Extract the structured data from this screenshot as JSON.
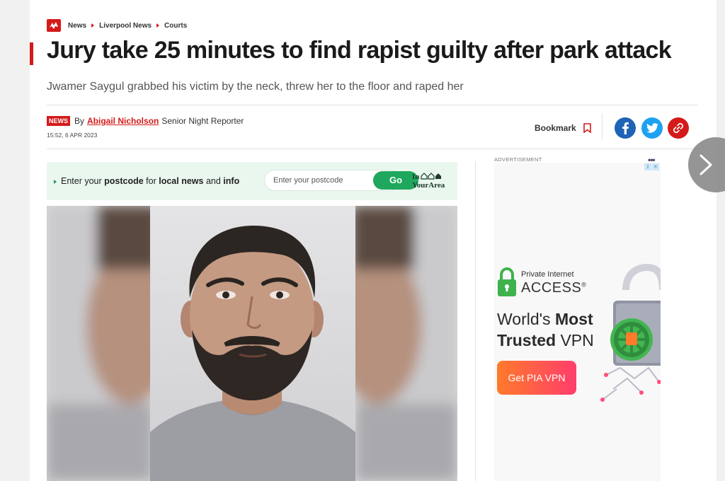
{
  "breadcrumb": {
    "items": [
      "News",
      "Liverpool News",
      "Courts"
    ]
  },
  "article": {
    "headline": "Jury take 25 minutes to find rapist guilty after park attack",
    "standfirst": "Jwamer Saygul grabbed his victim by the neck, threw her to the floor and raped her",
    "tag": "NEWS",
    "by": "By",
    "author": "Abigail Nicholson",
    "role": "Senior Night Reporter",
    "date": "15:52, 6 APR 2023"
  },
  "actions": {
    "bookmark_label": "Bookmark",
    "social": [
      {
        "name": "facebook",
        "icon": "facebook-icon"
      },
      {
        "name": "twitter",
        "icon": "twitter-icon"
      },
      {
        "name": "copy-link",
        "icon": "link-icon"
      }
    ]
  },
  "postcode": {
    "prefix": "Enter your ",
    "b1": "postcode",
    "mid1": " for ",
    "b2": "local news",
    "mid2": " and ",
    "b3": "info",
    "placeholder": "Enter your postcode",
    "go_label": "Go",
    "logo_line1": "In",
    "logo_line2": "YourArea"
  },
  "ad": {
    "label": "ADVERTISEMENT",
    "menu": "•••",
    "brand_line1": "Private Internet",
    "brand_line2": "ACCESS",
    "reg": "®",
    "headline_a": "World's ",
    "headline_b": "Most",
    "headline_c": "Trusted",
    "headline_d": " VPN",
    "cta": "Get PIA VPN"
  },
  "colors": {
    "brand_red": "#d41a1a",
    "go_green": "#1fa85d",
    "facebook": "#1e63b6",
    "twitter": "#1da1f2"
  }
}
